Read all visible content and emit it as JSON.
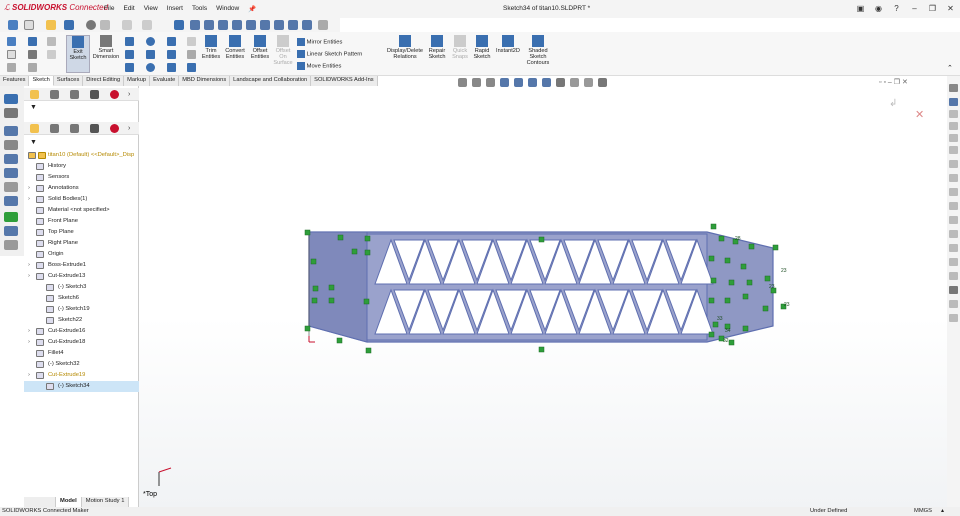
{
  "app": {
    "name_bold": "SOLIDWORKS",
    "name_suffix": "Connected",
    "document_title": "Sketch34 of titan10.SLDPRT *"
  },
  "menu": [
    "File",
    "Edit",
    "View",
    "Insert",
    "Tools",
    "Window"
  ],
  "ribbon": {
    "exit_sketch": "Exit Sketch",
    "smart_dimension": "Smart Dimension",
    "trim_entities": "Trim Entities",
    "convert_entities": "Convert Entities",
    "offset_entities": "Offset Entities",
    "offset_on_surface": "Offset On Surface",
    "mirror_entities": "Mirror Entities",
    "linear_sketch_pattern": "Linear Sketch Pattern",
    "move_entities": "Move Entities",
    "display_delete_relations": "Display/Delete Relations",
    "repair_sketch": "Repair Sketch",
    "quick_snaps": "Quick Snaps",
    "rapid_sketch": "Rapid Sketch",
    "instant2d": "Instant2D",
    "shaded_sketch_contours": "Shaded Sketch Contours"
  },
  "tabs": [
    "Features",
    "Sketch",
    "Surfaces",
    "Direct Editing",
    "Markup",
    "Evaluate",
    "MBD Dimensions",
    "Landscape and Collaboration",
    "SOLIDWORKS Add-Ins"
  ],
  "tree": {
    "root": "titan10 (Default) <<Default>_Disp",
    "items": [
      {
        "label": "History",
        "exp": false
      },
      {
        "label": "Sensors",
        "exp": false
      },
      {
        "label": "Annotations",
        "exp": true
      },
      {
        "label": "Solid Bodies(1)",
        "exp": true
      },
      {
        "label": "Material <not specified>",
        "exp": false
      },
      {
        "label": "Front Plane",
        "exp": false
      },
      {
        "label": "Top Plane",
        "exp": false
      },
      {
        "label": "Right Plane",
        "exp": false
      },
      {
        "label": "Origin",
        "exp": false
      },
      {
        "label": "Boss-Extrude1",
        "exp": true
      },
      {
        "label": "Cut-Extrude13",
        "exp": true
      },
      {
        "label": "(-) Sketch3",
        "exp": false
      },
      {
        "label": "Sketch6",
        "exp": false
      },
      {
        "label": "(-) Sketch19",
        "exp": false
      },
      {
        "label": "Sketch22",
        "exp": false
      },
      {
        "label": "Cut-Extrude16",
        "exp": true
      },
      {
        "label": "Cut-Extrude18",
        "exp": true
      },
      {
        "label": "Fillet4",
        "exp": false
      },
      {
        "label": "(-) Sketch32",
        "exp": false
      },
      {
        "label": "Cut-Extrude19",
        "exp": true
      },
      {
        "label": "(-) Sketch34",
        "exp": false
      }
    ]
  },
  "bottom_tabs": [
    "Model",
    "Motion Study 1"
  ],
  "viewport": {
    "view_label": "*Top",
    "dim_labels": [
      "28",
      "23",
      "23",
      "23",
      "34",
      "32",
      "33"
    ]
  },
  "status": {
    "left": "SOLIDWORKS Connected Maker",
    "state": "Under Defined",
    "units": "MMGS"
  },
  "colors": {
    "accent": "#c8102e",
    "part_fill": "#8f98c4",
    "part_edge": "#5f6fb0",
    "relation_marker": "#2e9e3a",
    "selection": "#cde5f7"
  }
}
